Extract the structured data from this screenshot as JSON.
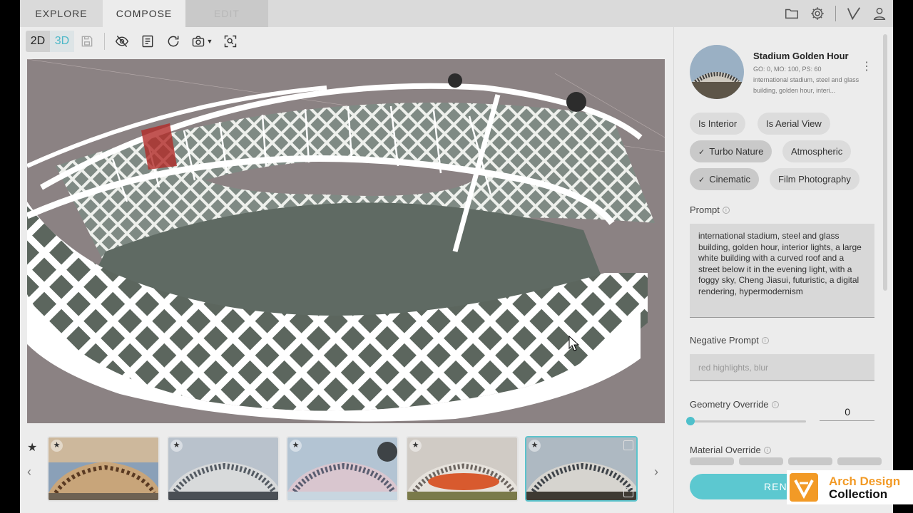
{
  "tabs": [
    {
      "label": "EXPLORE"
    },
    {
      "label": "COMPOSE"
    },
    {
      "label": "EDIT"
    }
  ],
  "top_icons": [
    "folder-icon",
    "gear-icon",
    "checkmark-icon",
    "user-icon"
  ],
  "toolbar": {
    "mode_2d": "2D",
    "mode_3d": "3D",
    "icons": [
      "save-icon",
      "hide-icon",
      "notes-icon",
      "refresh-icon",
      "camera-icon",
      "focus-icon"
    ]
  },
  "thumbnails": {
    "star": "★",
    "prev": "‹",
    "next": "›",
    "selected_index": 4
  },
  "preset": {
    "title": "Stadium Golden Hour",
    "meta": "GO: 0, MO: 100, PS: 60",
    "desc": "international stadium, steel and glass building, golden hour, interi...",
    "menu": "⋮"
  },
  "chips": [
    {
      "label": "Is Interior",
      "active": false
    },
    {
      "label": "Is Aerial View",
      "active": false
    },
    {
      "label": "Turbo Nature",
      "active": true
    },
    {
      "label": "Atmospheric",
      "active": false
    },
    {
      "label": "Cinematic",
      "active": true
    },
    {
      "label": "Film Photography",
      "active": false
    }
  ],
  "check_glyph": "✓",
  "prompt": {
    "label": "Prompt",
    "value": "international stadium, steel and glass building, golden hour, interior lights, a large white building with a curved roof and a street below it in the evening light, with a foggy sky, Cheng Jiasui, futuristic, a digital rendering, hypermodernism"
  },
  "negative_prompt": {
    "label": "Negative Prompt",
    "placeholder": "red highlights, blur"
  },
  "geometry_override": {
    "label": "Geometry Override",
    "value": "0",
    "level": 0
  },
  "material_override": {
    "label": "Material Override"
  },
  "info_glyph": "i",
  "render_button": "REND",
  "watermark": {
    "line1": "Arch Design",
    "line2": "Collection"
  },
  "colors": {
    "accent": "#5cc8d0",
    "viewport_bg": "#8b8283",
    "brand_orange": "#f29a26"
  }
}
